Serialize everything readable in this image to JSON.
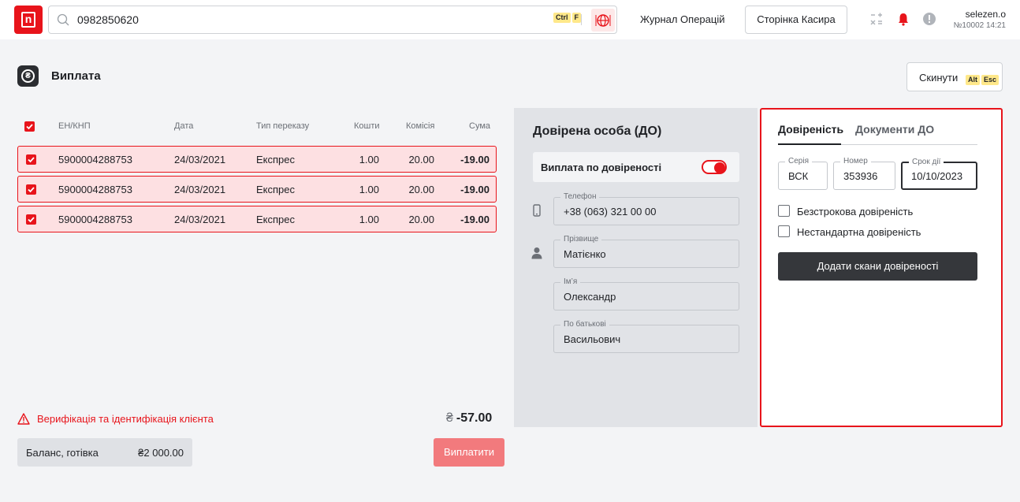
{
  "topbar": {
    "logo_text": "n",
    "search_value": "0982850620",
    "search_shortcut": [
      "Ctrl",
      "F"
    ],
    "journal_label": "Журнал Операцій",
    "cashier_label": "Сторінка Касира",
    "user_name": "selezen.o",
    "user_shift": "№10002 14:21",
    "accent": "#e8141b"
  },
  "page": {
    "title": "Виплата",
    "icon_glyph": "₴",
    "reset_label": "Скинути",
    "reset_shortcut": [
      "Alt",
      "Esc"
    ]
  },
  "table": {
    "columns": [
      "ЕН/КНП",
      "Дата",
      "Тип переказу",
      "Кошти",
      "Комісія",
      "Сума"
    ],
    "rows": [
      {
        "en": "5900004288753",
        "date": "24/03/2021",
        "type": "Експрес",
        "funds": "1.00",
        "fee": "20.00",
        "sum": "-19.00"
      },
      {
        "en": "5900004288753",
        "date": "24/03/2021",
        "type": "Експрес",
        "funds": "1.00",
        "fee": "20.00",
        "sum": "-19.00"
      },
      {
        "en": "5900004288753",
        "date": "24/03/2021",
        "type": "Експрес",
        "funds": "1.00",
        "fee": "20.00",
        "sum": "-19.00"
      }
    ]
  },
  "footer": {
    "verify_text": "Верифікація та ідентифікація клієнта",
    "total_currency": "₴",
    "total_value": "-57.00",
    "balance_label": "Баланс, готівка",
    "balance_value": "₴2 000.00",
    "pay_label": "Виплатити"
  },
  "trustee": {
    "title": "Довірена особа (ДО)",
    "toggle_label": "Виплата по довіреності",
    "toggle_on": true,
    "fields": [
      {
        "label": "Телефон",
        "value": "+38 (063) 321 00 00"
      },
      {
        "label": "Прізвище",
        "value": "Матієнко"
      },
      {
        "label": "Ім’я",
        "value": "Олександр"
      },
      {
        "label": "По батькові",
        "value": "Васильович"
      }
    ]
  },
  "poa": {
    "tab_active": "Довіреність",
    "tab_inactive": "Документи ДО",
    "series_label": "Серія",
    "series_value": "ВСК",
    "number_label": "Номер",
    "number_value": "353936",
    "expiry_label": "Срок дії",
    "expiry_value": "10/10/2023",
    "check_indefinite": "Безстрокова довіреність",
    "check_nonstandard": "Нестандартна довіреність",
    "scan_button": "Додати скани довіреності"
  }
}
